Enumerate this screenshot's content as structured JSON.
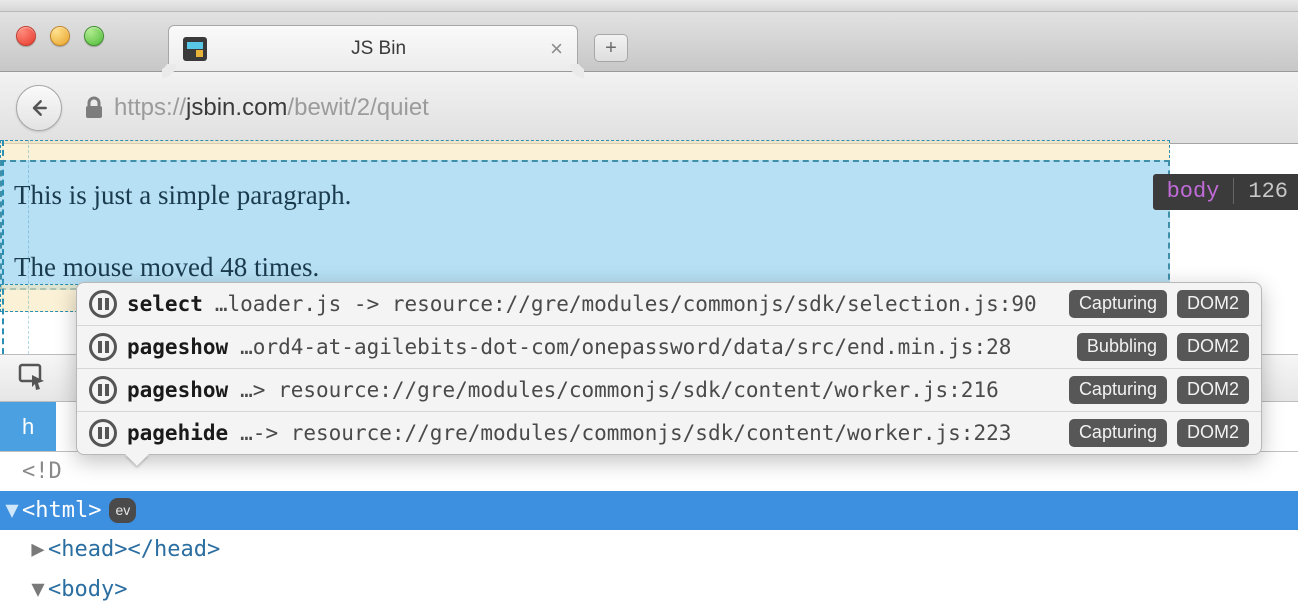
{
  "browser": {
    "tab_title": "JS Bin",
    "url_scheme": "https://",
    "url_host": "jsbin.com",
    "url_path": "/bewit/2/quiet"
  },
  "page": {
    "paragraph1": "This is just a simple paragraph.",
    "paragraph2": "The mouse moved 48 times.",
    "dim_badge_tag": "body",
    "dim_badge_size": "126"
  },
  "events": [
    {
      "name": "select",
      "source": "…loader.js -> resource://gre/modules/commonjs/sdk/selection.js:90",
      "phase": "Capturing",
      "level": "DOM2"
    },
    {
      "name": "pageshow",
      "source": "…ord4-at-agilebits-dot-com/onepassword/data/src/end.min.js:28",
      "phase": "Bubbling",
      "level": "DOM2"
    },
    {
      "name": "pageshow",
      "source": "…> resource://gre/modules/commonjs/sdk/content/worker.js:216",
      "phase": "Capturing",
      "level": "DOM2"
    },
    {
      "name": "pagehide",
      "source": "…-> resource://gre/modules/commonjs/sdk/content/worker.js:223",
      "phase": "Capturing",
      "level": "DOM2"
    }
  ],
  "devtools": {
    "active_tab_letter": "h",
    "doctype_fragment": "<!D",
    "node_html_open": "<html>",
    "ev_badge": "ev",
    "node_head": "<head></head>",
    "node_body_open": "<body>"
  }
}
